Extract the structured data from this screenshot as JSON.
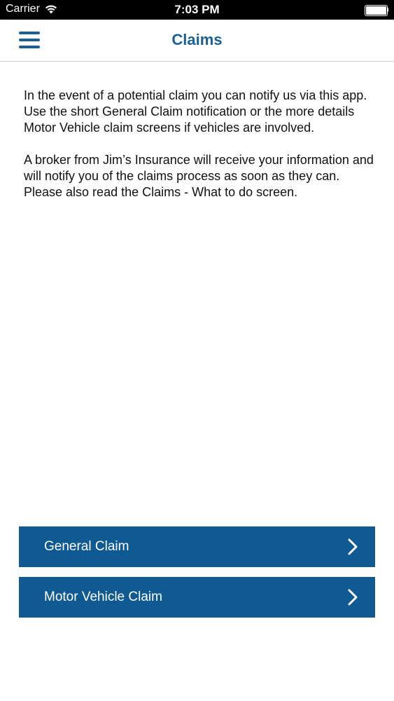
{
  "status_bar": {
    "carrier": "Carrier",
    "time": "7:03 PM",
    "wifi_icon": "wifi-icon",
    "battery_icon": "battery-icon"
  },
  "nav": {
    "title": "Claims",
    "menu_icon": "hamburger-menu-icon"
  },
  "content": {
    "paragraph_1": "In the event of a potential claim you can notify us via this app.  Use the short General Claim notification or the more details Motor Vehicle claim screens if vehicles are involved.",
    "paragraph_2": "A broker from Jim’s Insurance will receive your information and will notify you of the claims process as soon as they can. Please also read the Claims - What to do screen."
  },
  "buttons": {
    "general_claim": "General Claim",
    "motor_vehicle_claim": "Motor Vehicle Claim",
    "chevron_icon": "chevron-right-icon"
  },
  "colors": {
    "accent": "#1a5f96",
    "button_background": "#0f5a93",
    "status_bar_background": "#000000"
  }
}
